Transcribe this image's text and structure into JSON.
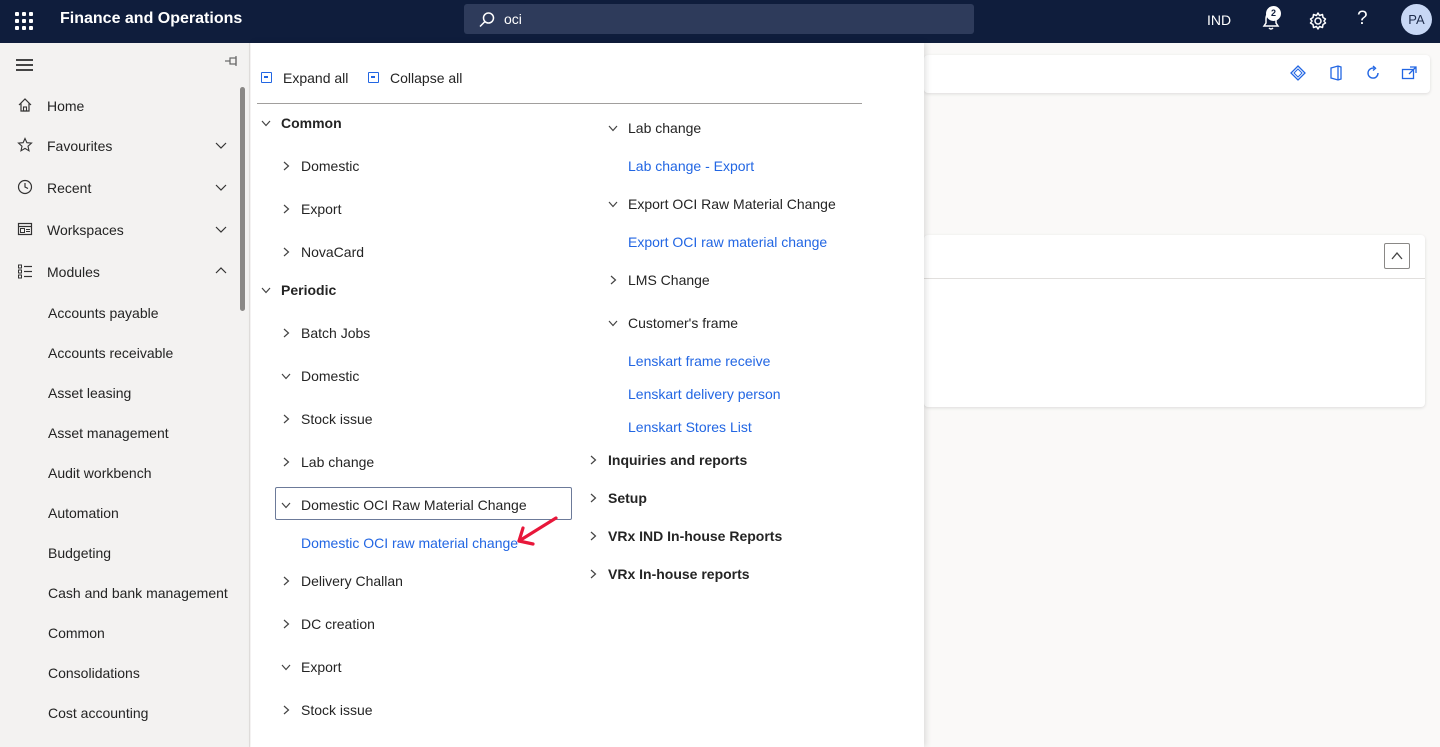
{
  "topbar": {
    "app_title": "Finance and Operations",
    "search_value": "oci",
    "company": "IND",
    "notification_count": "2",
    "help_label": "?",
    "avatar_initials": "PA"
  },
  "sidebar": {
    "items": [
      {
        "label": "Home",
        "icon": "home-icon"
      },
      {
        "label": "Favourites",
        "icon": "star-icon"
      },
      {
        "label": "Recent",
        "icon": "clock-icon"
      },
      {
        "label": "Workspaces",
        "icon": "workspace-icon"
      },
      {
        "label": "Modules",
        "icon": "list-icon"
      }
    ],
    "modules": [
      "Accounts payable",
      "Accounts receivable",
      "Asset leasing",
      "Asset management",
      "Audit workbench",
      "Automation",
      "Budgeting",
      "Cash and bank management",
      "Common",
      "Consolidations",
      "Cost accounting"
    ]
  },
  "flyout": {
    "expand_all": "Expand all",
    "collapse_all": "Collapse all",
    "left": [
      {
        "label": "Common",
        "type": "group",
        "state": "expanded"
      },
      {
        "label": "Domestic",
        "type": "node",
        "state": "collapsed"
      },
      {
        "label": "Export",
        "type": "node",
        "state": "collapsed"
      },
      {
        "label": "NovaCard",
        "type": "node",
        "state": "collapsed"
      },
      {
        "label": "Periodic",
        "type": "group",
        "state": "expanded"
      },
      {
        "label": "Batch Jobs",
        "type": "node",
        "state": "collapsed"
      },
      {
        "label": "Domestic",
        "type": "node",
        "state": "expanded"
      },
      {
        "label": "Stock issue",
        "type": "node",
        "state": "collapsed"
      },
      {
        "label": "Lab change",
        "type": "node",
        "state": "collapsed"
      },
      {
        "label": "Domestic OCI Raw Material Change",
        "type": "node",
        "state": "expanded"
      },
      {
        "label": "Domestic OCI raw material change",
        "type": "link"
      },
      {
        "label": "Delivery Challan",
        "type": "node",
        "state": "collapsed"
      },
      {
        "label": "DC creation",
        "type": "node",
        "state": "collapsed"
      },
      {
        "label": "Export",
        "type": "node",
        "state": "expanded"
      },
      {
        "label": "Stock issue",
        "type": "node",
        "state": "collapsed"
      }
    ],
    "right": [
      {
        "label": "Lab change",
        "type": "node",
        "state": "expanded"
      },
      {
        "label": "Lab change - Export",
        "type": "link"
      },
      {
        "label": "Export OCI Raw Material Change",
        "type": "node",
        "state": "expanded"
      },
      {
        "label": "Export OCI raw material change",
        "type": "link"
      },
      {
        "label": "LMS Change",
        "type": "node",
        "state": "collapsed"
      },
      {
        "label": "Customer's frame",
        "type": "node",
        "state": "expanded"
      },
      {
        "label": "Lenskart frame receive",
        "type": "link"
      },
      {
        "label": "Lenskart delivery person",
        "type": "link"
      },
      {
        "label": "Lenskart Stores List",
        "type": "link"
      },
      {
        "label": "Inquiries and reports",
        "type": "group",
        "state": "collapsed"
      },
      {
        "label": "Setup",
        "type": "group",
        "state": "collapsed"
      },
      {
        "label": "VRx IND In-house Reports",
        "type": "group",
        "state": "collapsed"
      },
      {
        "label": "VRx In-house reports",
        "type": "group",
        "state": "collapsed"
      }
    ]
  },
  "colors": {
    "topbar": "#0f1d3c",
    "link": "#2266e3",
    "annotation_arrow": "#e8173a"
  }
}
